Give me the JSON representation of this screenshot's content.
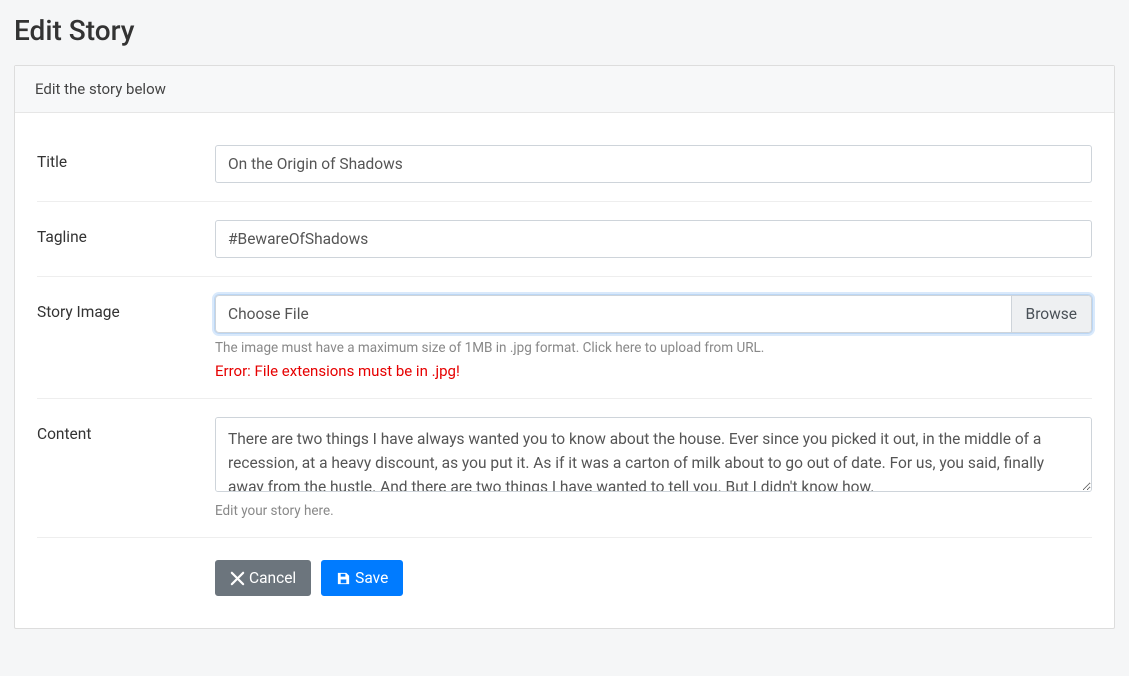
{
  "page_title": "Edit Story",
  "panel_header": "Edit the story below",
  "labels": {
    "title": "Title",
    "tagline": "Tagline",
    "story_image": "Story Image",
    "content": "Content"
  },
  "fields": {
    "title": "On the Origin of Shadows",
    "tagline": "#BewareOfShadows",
    "file_placeholder": "Choose File",
    "browse_label": "Browse",
    "image_help": "The image must have a maximum size of 1MB in .jpg format. Click here to upload from URL.",
    "image_error": "Error: File extensions must be in .jpg!",
    "content": "There are two things I have always wanted you to know about the house. Ever since you picked it out, in the middle of a recession, at a heavy discount, as you put it. As if it was a carton of milk about to go out of date. For us, you said, finally away from the hustle. And there are two things I have wanted to tell you. But I didn't know how.",
    "content_help": "Edit your story here."
  },
  "buttons": {
    "cancel": "Cancel",
    "save": "Save"
  }
}
